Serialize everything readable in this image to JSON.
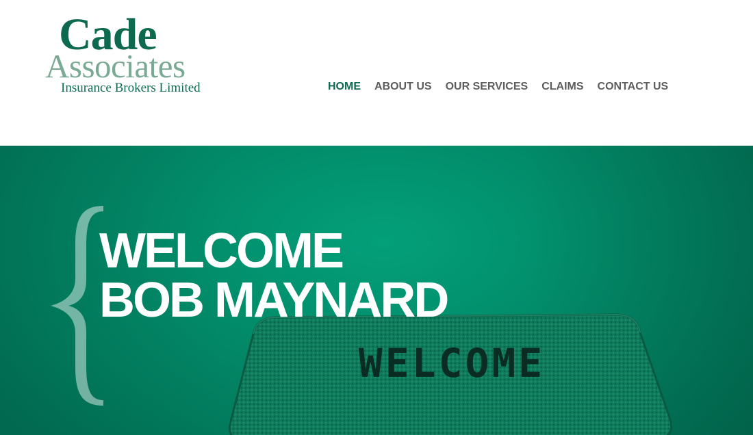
{
  "logo": {
    "line1": "Cade",
    "line2": "Associates",
    "line3": "Insurance Brokers Limited"
  },
  "nav": {
    "items": [
      {
        "label": "HOME",
        "active": true
      },
      {
        "label": "ABOUT US",
        "active": false
      },
      {
        "label": "OUR SERVICES",
        "active": false
      },
      {
        "label": "CLAIMS",
        "active": false
      },
      {
        "label": "CONTACT US",
        "active": false
      }
    ]
  },
  "hero": {
    "line1": "WELCOME",
    "line2": "BOB MAYNARD",
    "mat_text": "WELCOME"
  },
  "colors": {
    "brand_green": "#0e6a4f",
    "brand_light_green": "#7aa994",
    "nav_text": "#5d5d5d",
    "hero_green": "#028a68"
  }
}
